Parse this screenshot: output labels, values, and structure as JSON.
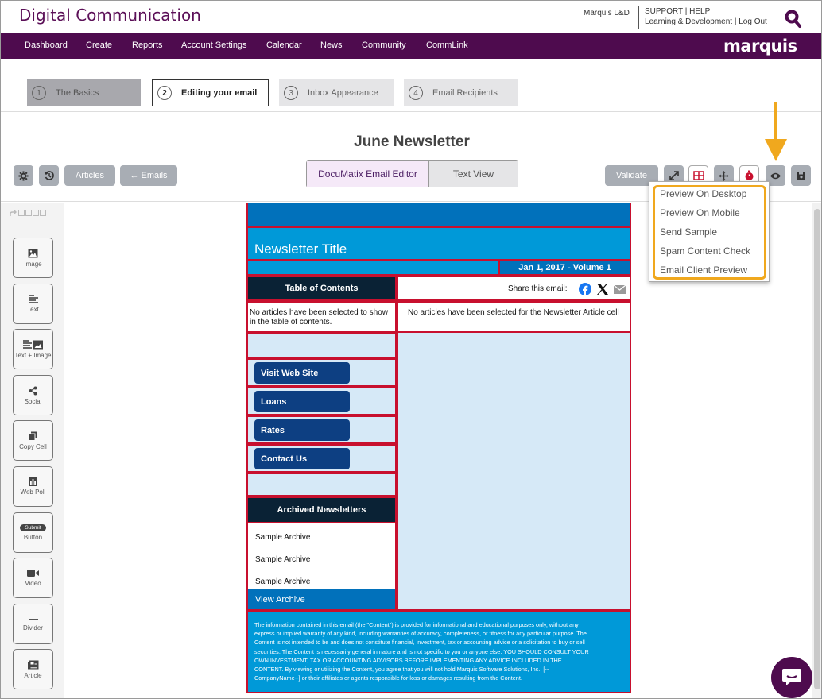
{
  "header": {
    "app_title": "Digital Communication",
    "user_name": "Marquis L&D",
    "support": "SUPPORT",
    "help": "HELP",
    "org": "Learning & Development",
    "logout": "Log Out"
  },
  "nav": {
    "items": [
      "Dashboard",
      "Create",
      "Reports",
      "Account Settings",
      "Calendar",
      "News",
      "Community",
      "CommLink"
    ],
    "brand": "marquis"
  },
  "steps": [
    {
      "num": "1",
      "label": "The Basics"
    },
    {
      "num": "2",
      "label": "Editing your email"
    },
    {
      "num": "3",
      "label": "Inbox Appearance"
    },
    {
      "num": "4",
      "label": "Email Recipients"
    }
  ],
  "toolbar": {
    "doc_title": "June Newsletter",
    "articles": "Articles",
    "emails": "← Emails",
    "editor_tab": "DocuMatix Email Editor",
    "text_view_tab": "Text View",
    "validate": "Validate"
  },
  "preview_menu": {
    "items": [
      "Preview On Desktop",
      "Preview On Mobile",
      "Send Sample",
      "Spam Content Check",
      "Email Client Preview"
    ]
  },
  "palette": {
    "tools": [
      "Image",
      "Text",
      "Text + Image",
      "Social",
      "Copy Cell",
      "Web Poll",
      "Button",
      "Video",
      "Divider",
      "Article"
    ],
    "submit_badge": "Submit"
  },
  "email": {
    "newsletter_title": "Newsletter Title",
    "date_volume": "Jan 1, 2017 - Volume 1",
    "toc_header": "Table of Contents",
    "toc_body": "No articles have been selected to show in the table of contents.",
    "share_label": "Share this email:",
    "article_body": "No articles have been selected for the Newsletter Article cell",
    "links": [
      "Visit Web Site",
      "Loans",
      "Rates",
      "Contact Us"
    ],
    "archive_header": "Archived Newsletters",
    "archive_items": [
      "Sample Archive",
      "Sample Archive",
      "Sample Archive"
    ],
    "view_archive": "View Archive",
    "footer_lines": [
      "The information contained in this email (the \"Content\") is provided for informational and educational purposes only, without any",
      "express or implied warranty of any kind, including warranties of accuracy, completeness, or fitness for any particular purpose. The",
      "Content is not intended to be and does not constitute financial, investment, tax or accounting advice or a solicitation to buy or sell",
      "securities. The Content is necessarily general in nature and is not specific to you or anyone else.  YOU SHOULD CONSULT YOUR",
      "OWN INVESTMENT, TAX OR ACCOUNTING ADVISORS BEFORE IMPLEMENTING ANY ADVICE INCLUDED IN THE",
      "CONTENT. By viewing or utilizing the Content, you agree that you will not hold Marquis Software Solutions, Inc., [--",
      "CompanyName--] or their affiliates or agents responsible for loss or damages resulting from the Content."
    ]
  },
  "colors": {
    "nav_bg": "#4e0b4e",
    "title_purple": "#5b0f57",
    "highlight": "#f0a81e",
    "email_blue": "#0099d8",
    "cell_border": "#c8102e"
  }
}
